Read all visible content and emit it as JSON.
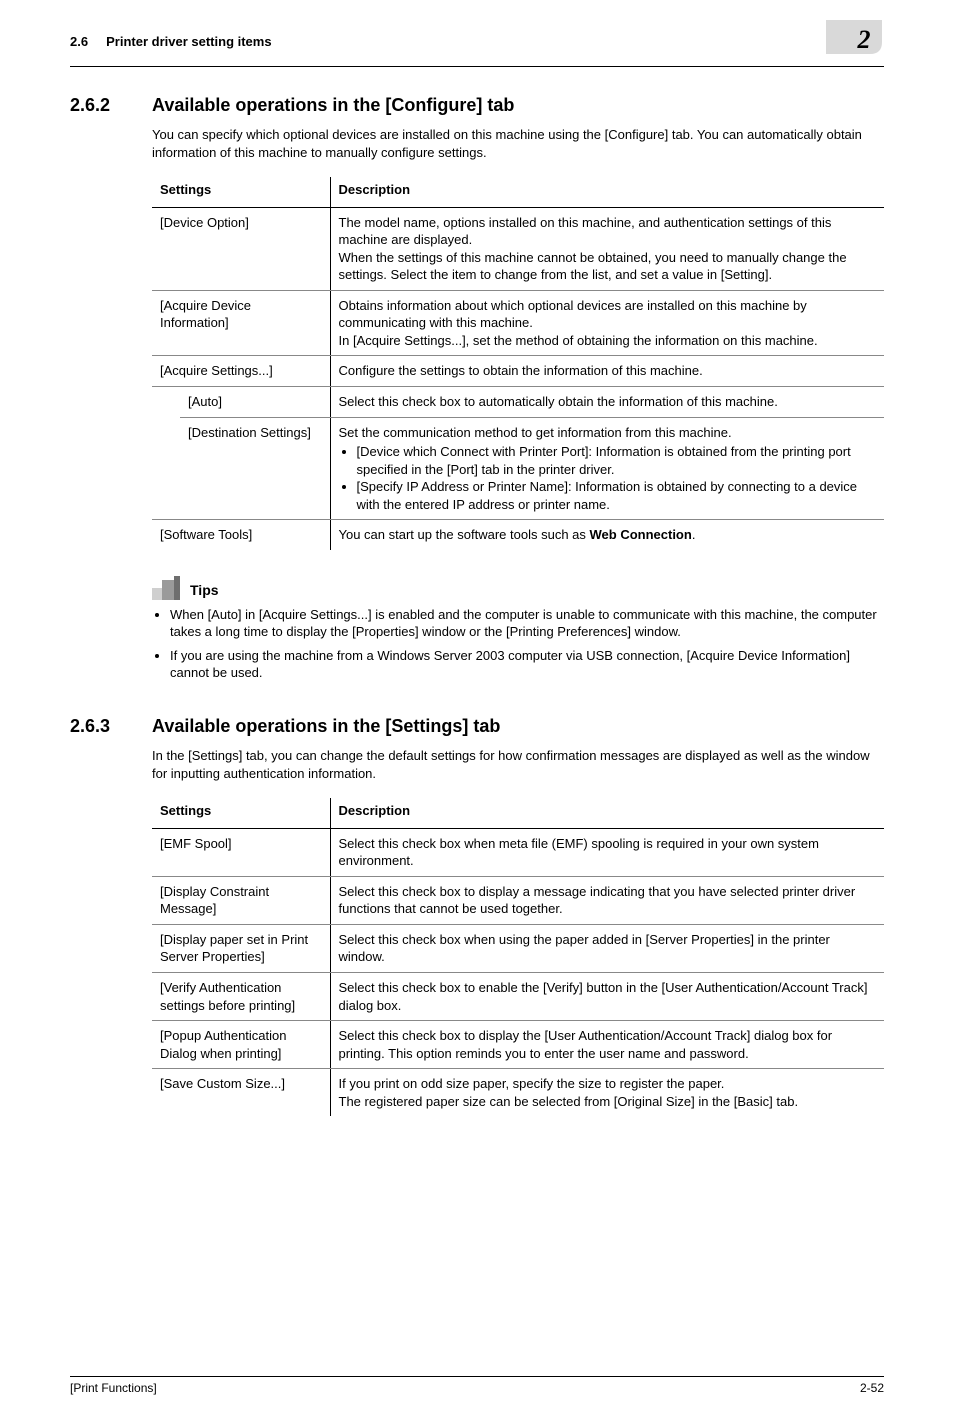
{
  "running_head": {
    "left_section": "2.6",
    "left_title": "Printer driver setting items",
    "badge_number": "2"
  },
  "s262": {
    "num": "2.6.2",
    "title": "Available operations in the [Configure] tab",
    "intro": "You can specify which optional devices are installed on this machine using the [Configure] tab. You can automatically obtain information of this machine to manually configure settings.",
    "hdr_settings": "Settings",
    "hdr_desc": "Description",
    "rows": {
      "device_option": {
        "label": "[Device Option]",
        "desc": "The model name, options installed on this machine, and authentication settings of this machine are displayed.\nWhen the settings of this machine cannot be obtained, you need to manually change the settings. Select the item to change from the list, and set a value in [Setting]."
      },
      "acquire_dev_info": {
        "label": "[Acquire Device Information]",
        "desc": "Obtains information about which optional devices are installed on this machine by communicating with this machine.\nIn [Acquire Settings...], set the method of obtaining the information on this machine."
      },
      "acquire_settings": {
        "label": "[Acquire Settings...]",
        "desc": "Configure the settings to obtain the information of this machine."
      },
      "auto": {
        "label": "[Auto]",
        "desc": "Select this check box to automatically obtain the information of this machine."
      },
      "dest_settings": {
        "label": "[Destination Settings]",
        "desc_lead": "Set the communication method to get information from this machine.",
        "b1": "[Device which Connect with Printer Port]: Information is obtained from the printing port specified in the [Port] tab in the printer driver.",
        "b2": "[Specify IP Address or Printer Name]: Information is obtained by connecting to a device with the entered IP address or printer name."
      },
      "software_tools": {
        "label": "[Software Tools]",
        "desc_pre": "You can start up the software tools such as ",
        "desc_bold": "Web Connection",
        "desc_post": "."
      }
    }
  },
  "tips": {
    "label": "Tips",
    "items": [
      "When [Auto] in [Acquire Settings...] is enabled and the computer is unable to communicate with this machine, the computer takes a long time to display the [Properties] window or the [Printing Preferences] window.",
      "If you are using the machine from a Windows Server 2003 computer via USB connection, [Acquire Device Information] cannot be used."
    ]
  },
  "s263": {
    "num": "2.6.3",
    "title": "Available operations in the [Settings] tab",
    "intro": "In the [Settings] tab, you can change the default settings for how confirmation messages are displayed as well as the window for inputting authentication information.",
    "hdr_settings": "Settings",
    "hdr_desc": "Description",
    "rows": {
      "emf": {
        "label": "[EMF Spool]",
        "desc": "Select this check box when meta file (EMF) spooling is required in your own system environment."
      },
      "disp_constraint": {
        "label": "[Display Constraint Message]",
        "desc": "Select this check box to display a message indicating that you have selected printer driver functions that cannot be used together."
      },
      "disp_paper": {
        "label": "[Display paper set in Print Server Properties]",
        "desc": "Select this check box when using the paper added in [Server Properties] in the printer window."
      },
      "verify_auth": {
        "label": "[Verify Authentication settings before printing]",
        "desc": "Select this check box to enable the [Verify] button in the [User Authentication/Account Track] dialog box."
      },
      "popup_auth": {
        "label": "[Popup Authentication Dialog when printing]",
        "desc": "Select this check box to display the [User Authentication/Account Track] dialog box for printing. This option reminds you to enter the user name and password."
      },
      "save_custom": {
        "label": "[Save Custom Size...]",
        "desc": "If you print on odd size paper, specify the size to register the paper.\nThe registered paper size can be selected from [Original Size] in the [Basic] tab."
      }
    }
  },
  "footer": {
    "left": "[Print Functions]",
    "right": "2-52"
  }
}
